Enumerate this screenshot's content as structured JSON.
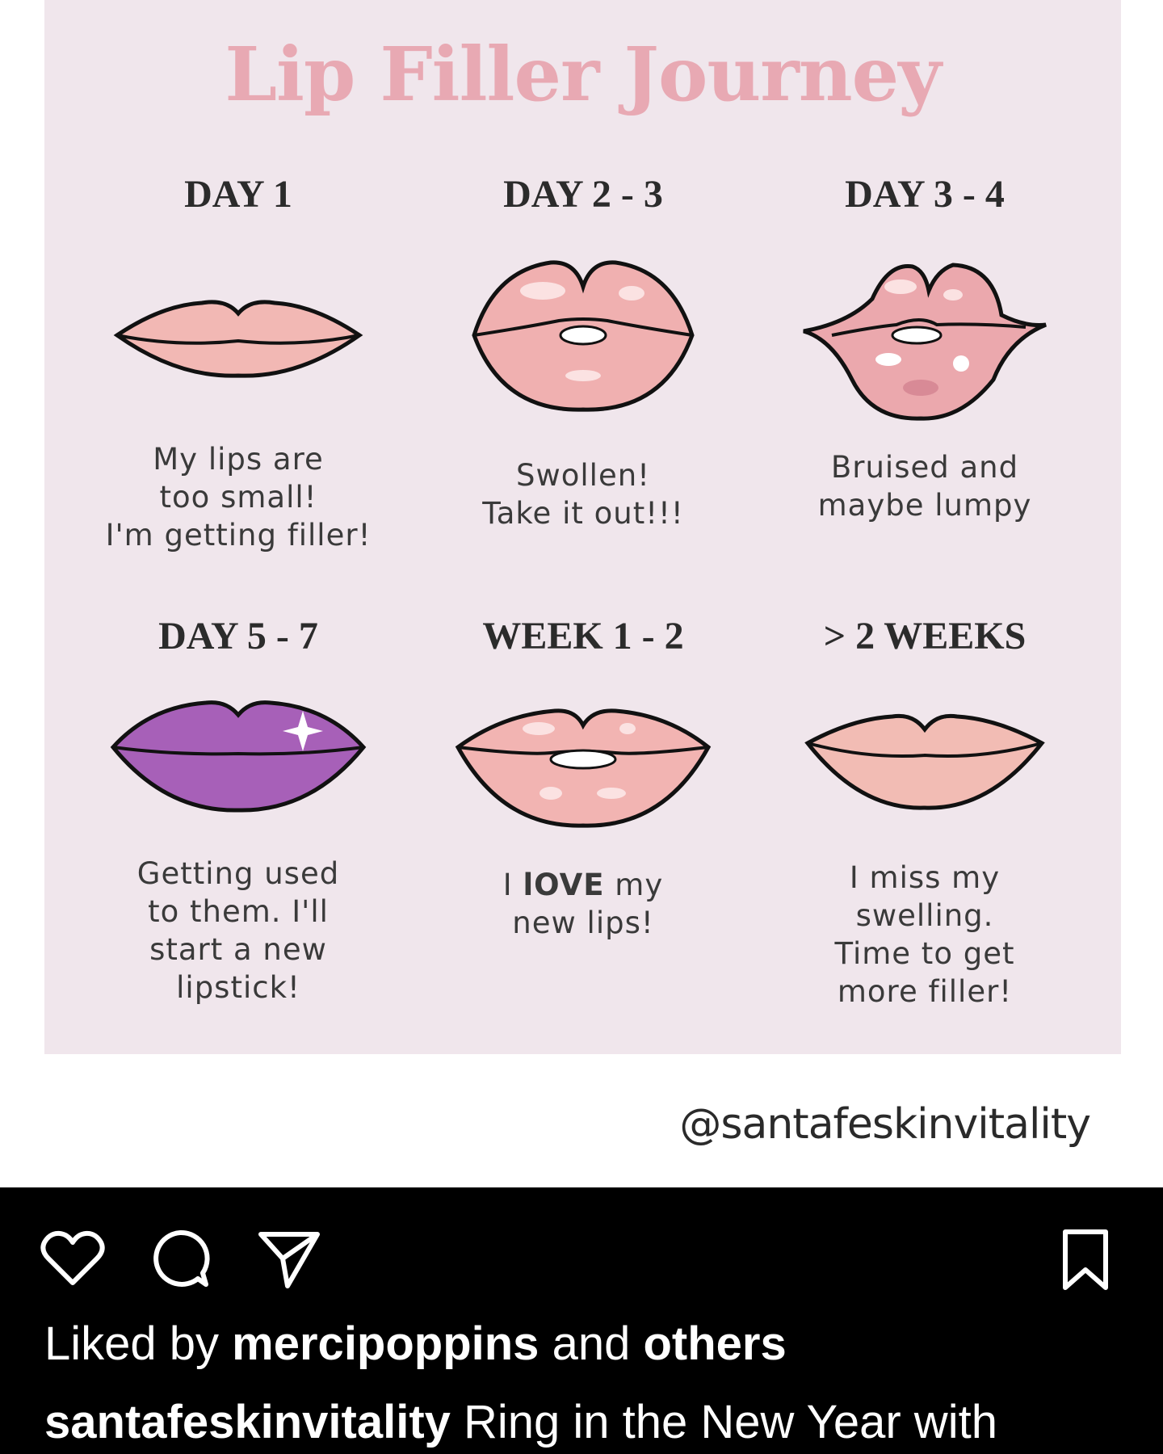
{
  "post": {
    "title": "Lip Filler Journey",
    "stages": [
      {
        "label": "DAY 1",
        "lines": [
          "My lips are",
          "too small!",
          "I'm getting filler!"
        ],
        "lip_color": "#f2b8b4"
      },
      {
        "label": "DAY 2 - 3",
        "lines": [
          "Swollen!",
          "Take it out!!!"
        ],
        "lip_color": "#f0b0b0"
      },
      {
        "label": "DAY 3 - 4",
        "lines": [
          "Bruised and",
          "maybe lumpy"
        ],
        "lip_color": "#eba8ad"
      },
      {
        "label": "DAY 5 - 7",
        "lines": [
          "Getting used",
          "to them. I'll",
          "start a new",
          "lipstick!"
        ],
        "lip_color": "#a760b8"
      },
      {
        "label": "WEEK 1 - 2",
        "line1_prefix": "I ",
        "line1_bold": "lOVE",
        "line1_suffix": " my",
        "line2": "new lips!",
        "lip_color": "#f2b4b2"
      },
      {
        "label": "> 2 WEEKS",
        "lines": [
          "I miss my",
          "swelling.",
          "Time to get",
          "more filler!"
        ],
        "lip_color": "#f2bcb4"
      }
    ],
    "watermark": "@santafeskinvitality"
  },
  "actions": {
    "icons": [
      "heart-icon",
      "comment-icon",
      "share-icon",
      "bookmark-icon"
    ]
  },
  "likes": {
    "prefix": "Liked by ",
    "user": "mercipoppins",
    "middle": " and ",
    "others": "others"
  },
  "caption": {
    "username": "santafeskinvitality",
    "text": " Ring in the New Year with"
  },
  "colors": {
    "card_bg": "#f0e6ec",
    "title": "#e8a9b3",
    "bar_bg": "#000000"
  }
}
